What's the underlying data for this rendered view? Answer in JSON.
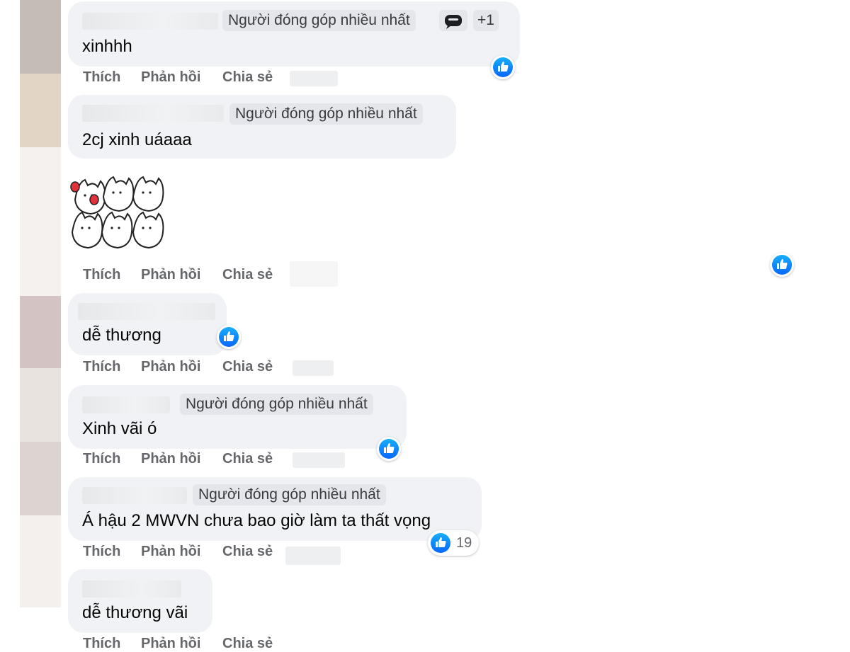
{
  "colors": {
    "bubble": "#f0f2f5",
    "like_blue": "#0866ff",
    "action_gray": "#65676b"
  },
  "actions": {
    "like": "Thích",
    "reply": "Phản hồi",
    "share": "Chia sẻ"
  },
  "comments": [
    {
      "badge": "Người đóng góp nhiều nhất",
      "extra_badge_icon": "chat-bubble-icon",
      "extra_badge": "+1",
      "text": "xinhhh",
      "reaction": "like-icon"
    },
    {
      "badge": "Người đóng góp nhiều nhất",
      "text": "2cj xinh uáaaa"
    },
    {
      "sticker": "dancing-cats-sticker",
      "reaction": "like-icon"
    },
    {
      "text": "dễ thương",
      "reaction": "like-icon"
    },
    {
      "badge": "Người đóng góp nhiều nhất",
      "text": "Xinh vãi ó",
      "reaction": "like-icon"
    },
    {
      "badge": "Người đóng góp nhiều nhất",
      "text": "Á hậu 2 MWVN chưa bao giờ làm ta thất vọng",
      "reaction": "like-icon",
      "reaction_count": "19"
    },
    {
      "text": "dễ thương vãi"
    }
  ]
}
